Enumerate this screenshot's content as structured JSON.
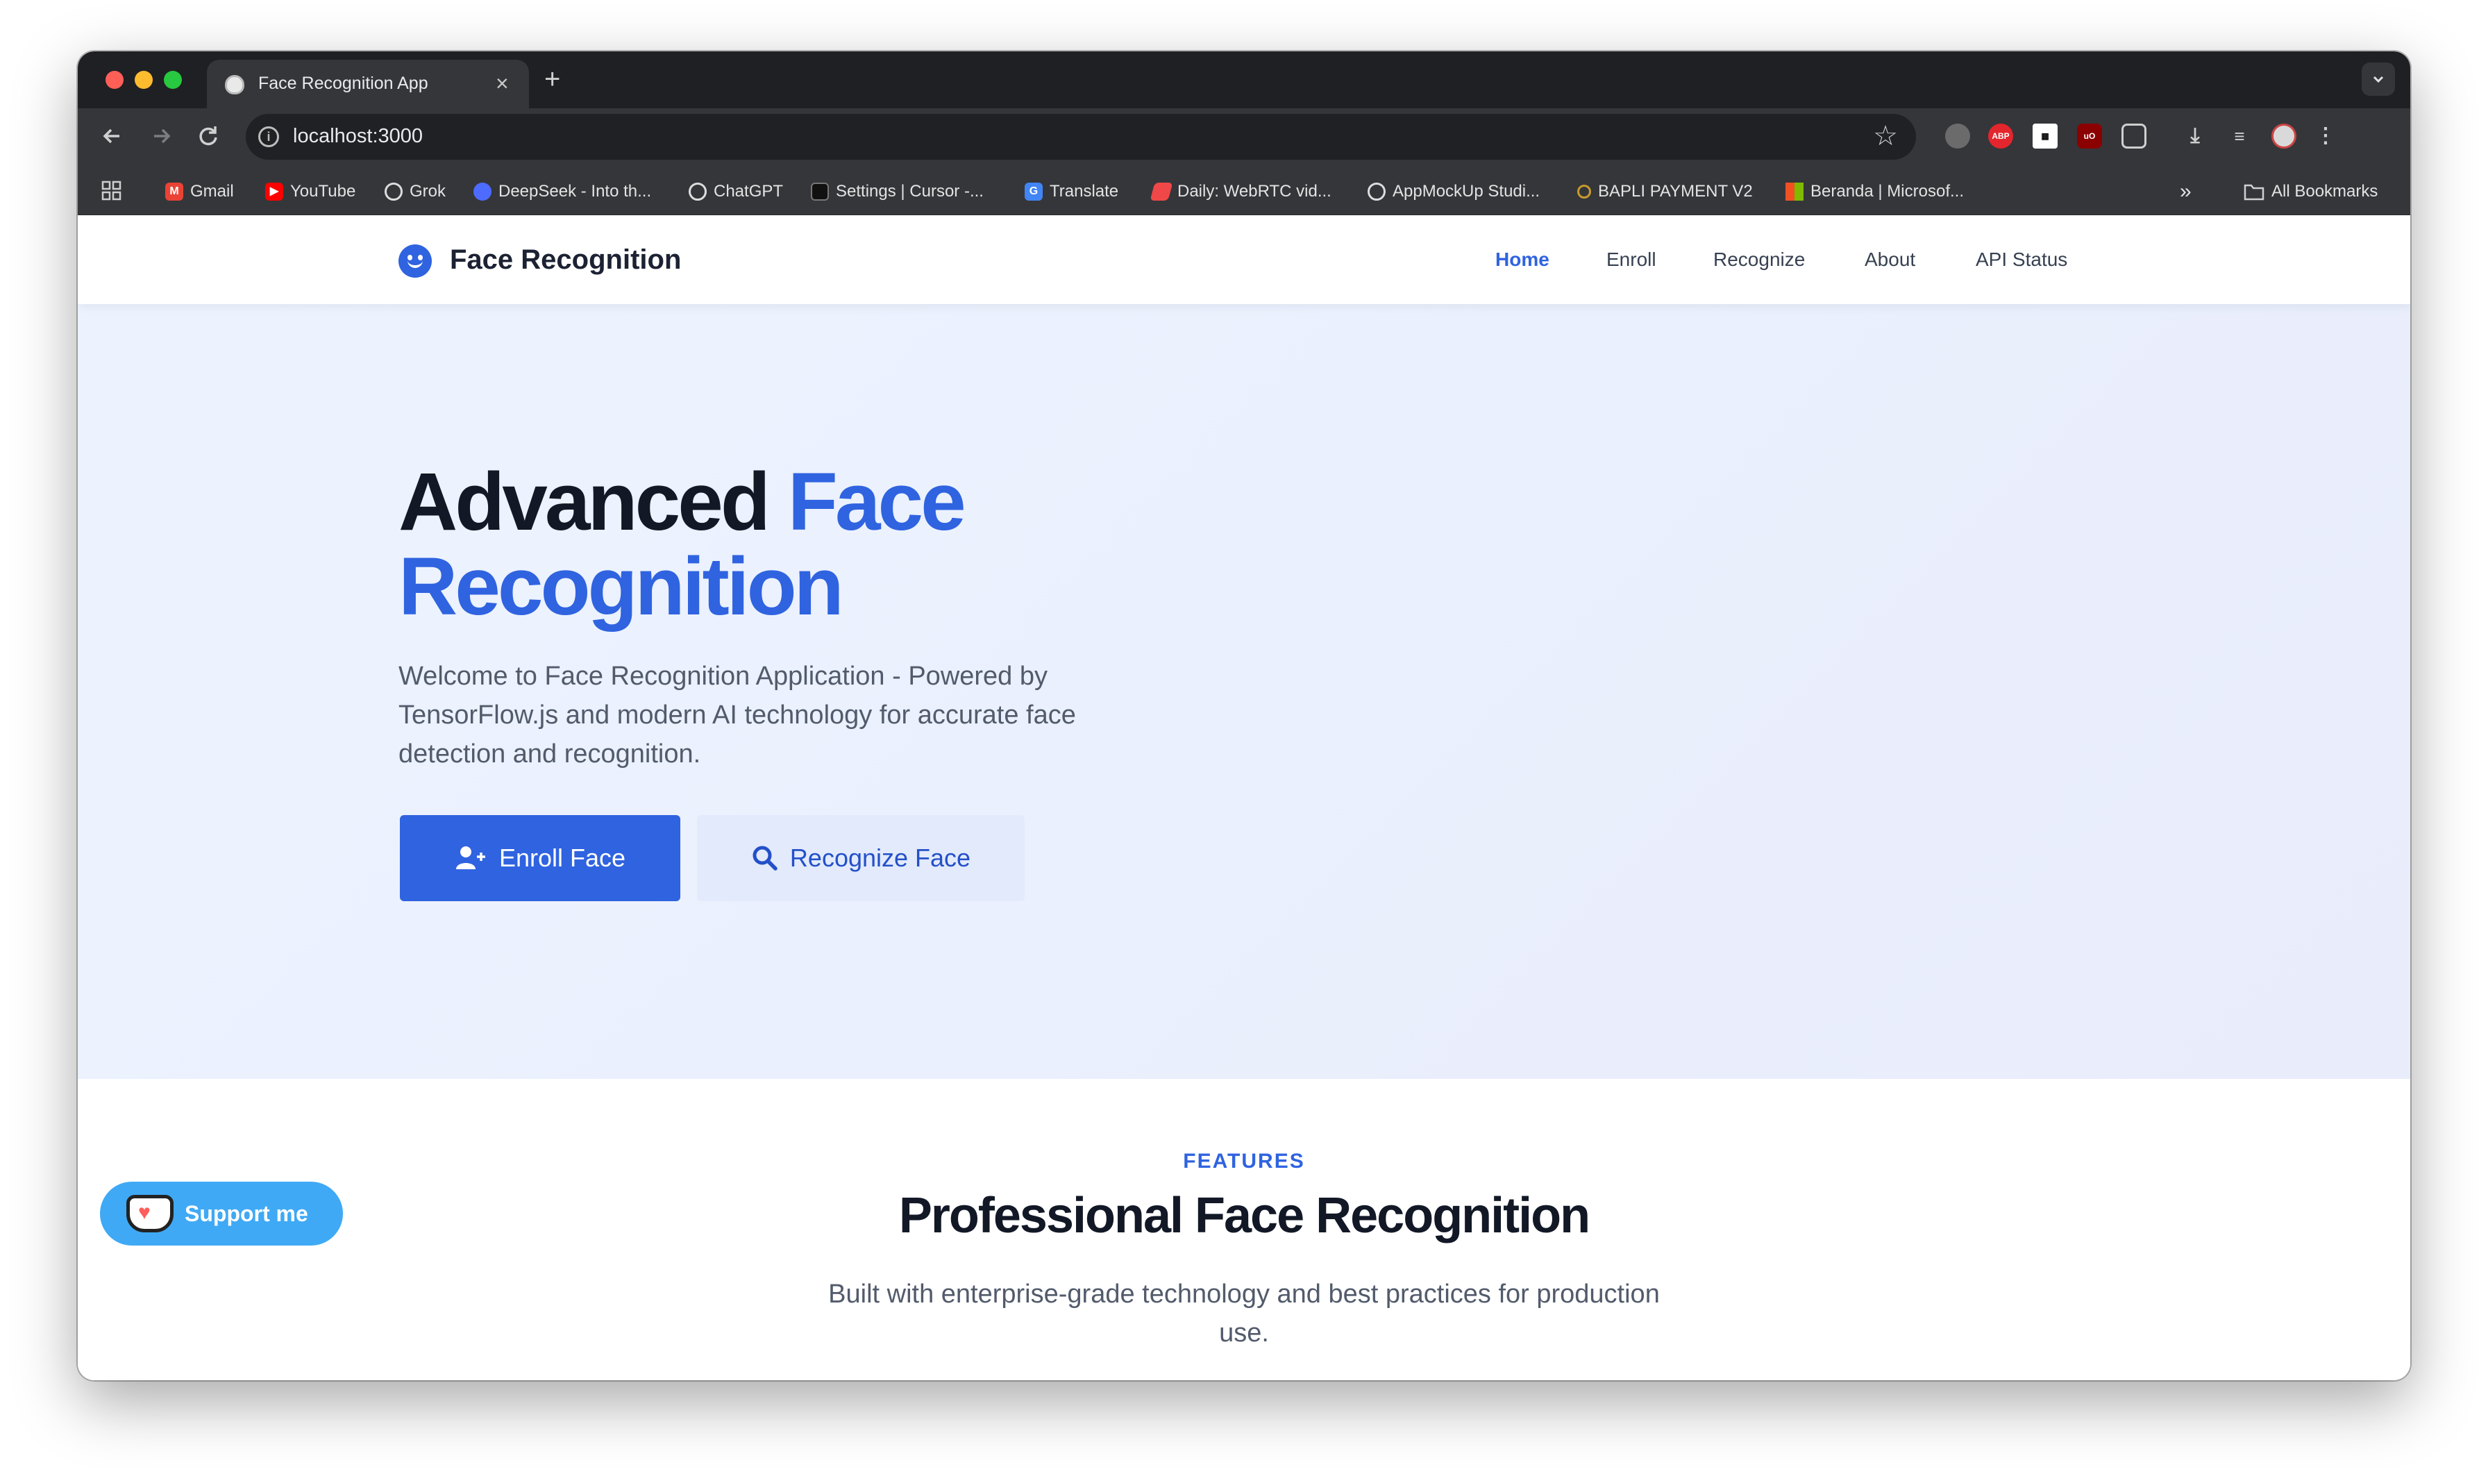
{
  "browser": {
    "tab_title": "Face Recognition App",
    "tab_close": "×",
    "new_tab": "+",
    "url": "localhost:3000",
    "bookmarks": [
      {
        "label": "Gmail",
        "icon": "gmail-icon",
        "color": "#ea4335"
      },
      {
        "label": "YouTube",
        "icon": "youtube-icon",
        "color": "#ff0000"
      },
      {
        "label": "Grok",
        "icon": "grok-icon",
        "color": "#333333"
      },
      {
        "label": "DeepSeek - Into th...",
        "icon": "deepseek-icon",
        "color": "#4d6bfe"
      },
      {
        "label": "ChatGPT",
        "icon": "chatgpt-icon",
        "color": "#444444"
      },
      {
        "label": "Settings | Cursor -...",
        "icon": "cursor-icon",
        "color": "#111111"
      },
      {
        "label": "Translate",
        "icon": "translate-icon",
        "color": "#4285f4"
      },
      {
        "label": "Daily: WebRTC vid...",
        "icon": "daily-icon",
        "color": "#f04848"
      },
      {
        "label": "AppMockUp Studi...",
        "icon": "appmockup-icon",
        "color": "#555555"
      },
      {
        "label": "BAPLI PAYMENT V2",
        "icon": "bapli-icon",
        "color": "#c79a2b"
      },
      {
        "label": "Beranda | Microsof...",
        "icon": "microsoft-icon",
        "color": "#f25022"
      }
    ],
    "bookmarks_more": "»",
    "all_bookmarks": "All Bookmarks"
  },
  "site": {
    "brand": "Face Recognition",
    "nav": [
      "Home",
      "Enroll",
      "Recognize",
      "About",
      "API Status"
    ],
    "accent_color": "#2f63e0"
  },
  "hero": {
    "title_part1": "Advanced",
    "title_part2": "Face",
    "title_part3": "Recognition",
    "description": "Welcome to Face Recognition Application - Powered by TensorFlow.js and modern AI technology for accurate face detection and recognition.",
    "primary_button": "Enroll Face",
    "secondary_button": "Recognize Face"
  },
  "features": {
    "eyebrow": "FEATURES",
    "title": "Professional Face Recognition",
    "description": "Built with enterprise-grade technology and best practices for production use."
  },
  "support": {
    "label": "Support me"
  }
}
